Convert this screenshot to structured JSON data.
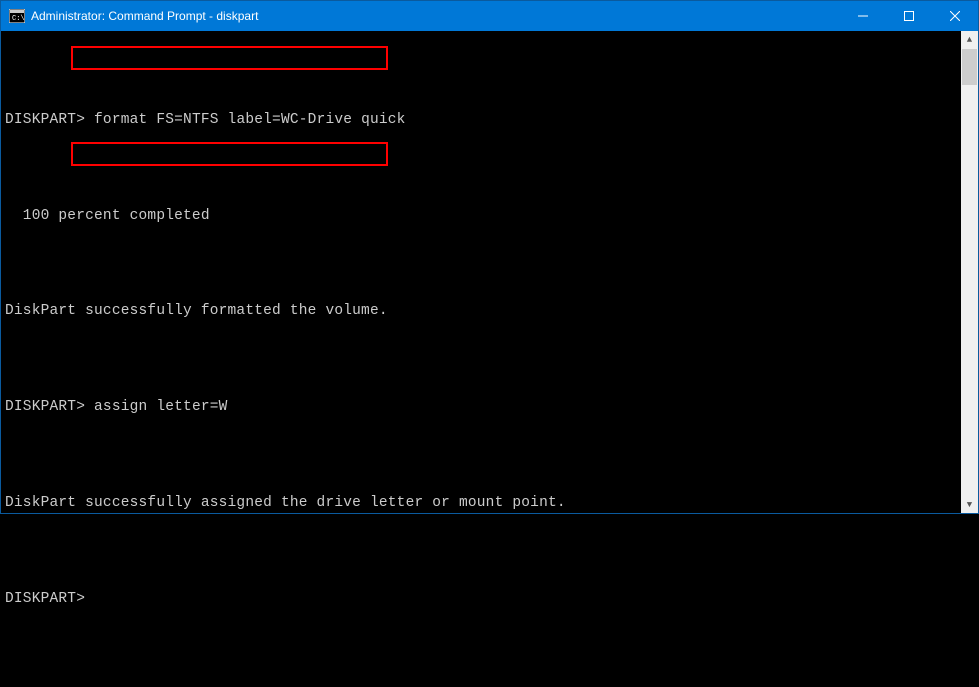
{
  "window": {
    "title": "Administrator: Command Prompt - diskpart"
  },
  "terminal": {
    "prompt": "DISKPART>",
    "lines": {
      "cmd1": "format FS=NTFS label=WC-Drive quick",
      "progress": "  100 percent completed",
      "result1": "DiskPart successfully formatted the volume.",
      "cmd2": "assign letter=W",
      "result2": "DiskPart successfully assigned the drive letter or mount point."
    }
  }
}
